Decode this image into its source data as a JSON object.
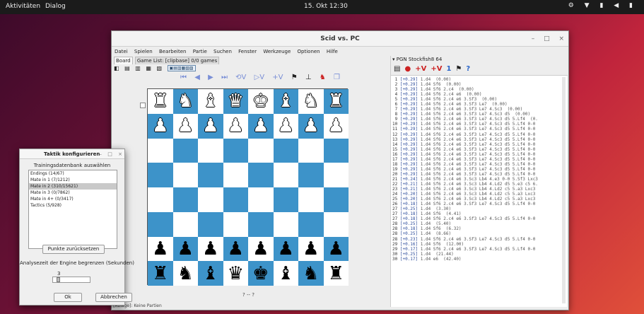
{
  "topbar": {
    "activities": "Aktivitäten",
    "app": "Dialog",
    "clock": "15. Okt 12:30",
    "tray": "⚙ ▼ ▮ ◀ ▮"
  },
  "window": {
    "title": "Scid vs. PC",
    "controls": [
      "–",
      "□",
      "×"
    ],
    "menu": [
      "Datei",
      "Spielen",
      "Bearbeiten",
      "Partie",
      "Suchen",
      "Fenster",
      "Werkzeuge",
      "Optionen",
      "Hilfe"
    ]
  },
  "board_panel": {
    "tabs": [
      "Board",
      "Game List: [clipbase] 0/0 games"
    ],
    "toolbar_icons": [
      "◧",
      "▤",
      "▥",
      "▦",
      "▧"
    ],
    "toolbar_box": "▣▤▥▦▧▨",
    "nav": [
      "⏮",
      "◀",
      "▶",
      "⏭",
      "⟲V",
      "▷V",
      "+V",
      "⚑",
      "⊥",
      "♞",
      "❐"
    ],
    "footer": "? -- ?",
    "status": "[Ablage]: Keine Partien"
  },
  "board": {
    "squares": [
      [
        "♜",
        "♞",
        "♝",
        "♛",
        "♚",
        "♝",
        "♞",
        "♜"
      ],
      [
        "♟",
        "♟",
        "♟",
        "♟",
        "♟",
        "♟",
        "♟",
        "♟"
      ],
      [
        "",
        "",
        "",
        "",
        "",
        "",
        "",
        ""
      ],
      [
        "",
        "",
        "",
        "",
        "",
        "",
        "",
        ""
      ],
      [
        "",
        "",
        "",
        "",
        "",
        "",
        "",
        ""
      ],
      [
        "",
        "",
        "",
        "",
        "",
        "",
        "",
        ""
      ],
      [
        "♟",
        "♟",
        "♟",
        "♟",
        "♟",
        "♟",
        "♟",
        "♟"
      ],
      [
        "♜",
        "♞",
        "♝",
        "♛",
        "♚",
        "♝",
        "♞",
        "♜"
      ]
    ],
    "colors": [
      [
        "w",
        "w",
        "w",
        "w",
        "w",
        "w",
        "w",
        "w"
      ],
      [
        "w",
        "w",
        "w",
        "w",
        "w",
        "w",
        "w",
        "w"
      ],
      [
        "",
        "",
        "",
        "",
        "",
        "",
        "",
        ""
      ],
      [
        "",
        "",
        "",
        "",
        "",
        "",
        "",
        ""
      ],
      [
        "",
        "",
        "",
        "",
        "",
        "",
        "",
        ""
      ],
      [
        "",
        "",
        "",
        "",
        "",
        "",
        "",
        ""
      ],
      [
        "b",
        "b",
        "b",
        "b",
        "b",
        "b",
        "b",
        "b"
      ],
      [
        "b",
        "b",
        "b",
        "b",
        "b",
        "b",
        "b",
        "b"
      ]
    ],
    "light": "#ffffff",
    "dark": "#3d93c9"
  },
  "engine_panel": {
    "tabs": "▾ PGN  Stockfish8 64",
    "toolbar": [
      [
        "▤",
        ""
      ],
      [
        "●",
        "r"
      ],
      [
        "+V",
        "r"
      ],
      [
        "+V",
        "r"
      ],
      [
        "1",
        "b"
      ],
      [
        "⚑",
        ""
      ],
      [
        "?",
        "b"
      ]
    ],
    "lines": [
      [
        "1",
        "[+0.29]",
        "1.d4  (0.00)"
      ],
      [
        "2",
        "[+0.29]",
        "1.d4 Sf6  (0.00)"
      ],
      [
        "3",
        "[+0.29]",
        "1.d4 Sf6 2.c4  (0.00)"
      ],
      [
        "4",
        "[+0.29]",
        "1.d4 Sf6 2.c4 e6  (0.00)"
      ],
      [
        "5",
        "[+0.29]",
        "1.d4 Sf6 2.c4 e6 3.Sf3  (0.00)"
      ],
      [
        "6",
        "[+0.29]",
        "1.d4 Sf6 2.c4 e6 3.Sf3 Le7  (0.00)"
      ],
      [
        "7",
        "[+0.29]",
        "1.d4 Sf6 2.c4 e6 3.Sf3 Le7 4.Sc3  (0.00)"
      ],
      [
        "8",
        "[+0.29]",
        "1.d4 Sf6 2.c4 e6 3.Sf3 Le7 4.Sc3 d5  (0.00)"
      ],
      [
        "9",
        "[+0.29]",
        "1.d4 Sf6 2.c4 e6 3.Sf3 Le7 4.Sc3 d5 5.Lf4  (0."
      ],
      [
        "10",
        "[+0.29]",
        "1.d4 Sf6 2.c4 e6 3.Sf3 Le7 4.Sc3 d5 5.Lf4 0-0"
      ],
      [
        "11",
        "[+0.29]",
        "1.d4 Sf6 2.c4 e6 3.Sf3 Le7 4.Sc3 d5 5.Lf4 0-0"
      ],
      [
        "12",
        "[+0.29]",
        "1.d4 Sf6 2.c4 e6 3.Sf3 Le7 4.Sc3 d5 5.Lf4 0-0"
      ],
      [
        "13",
        "[+0.29]",
        "1.d4 Sf6 2.c4 e6 3.Sf3 Le7 4.Sc3 d5 5.Lf4 0-0"
      ],
      [
        "14",
        "[+0.29]",
        "1.d4 Sf6 2.c4 e6 3.Sf3 Le7 4.Sc3 d5 5.Lf4 0-0"
      ],
      [
        "15",
        "[+0.29]",
        "1.d4 Sf6 2.c4 e6 3.Sf3 Le7 4.Sc3 d5 5.Lf4 0-0"
      ],
      [
        "16",
        "[+0.29]",
        "1.d4 Sf6 2.c4 e6 3.Sf3 Le7 4.Sc3 d5 5.Lf4 0-0"
      ],
      [
        "17",
        "[+0.29]",
        "1.d4 Sf6 2.c4 e6 3.Sf3 Le7 4.Sc3 d5 5.Lf4 0-0"
      ],
      [
        "18",
        "[+0.29]",
        "1.d4 Sf6 2.c4 e6 3.Sf3 Le7 4.Sc3 d5 5.Lf4 0-0"
      ],
      [
        "19",
        "[+0.29]",
        "1.d4 Sf6 2.c4 e6 3.Sf3 Le7 4.Sc3 d5 5.Lf4 0-0"
      ],
      [
        "20",
        "[+0.29]",
        "1.d4 Sf6 2.c4 e6 3.Sf3 Le7 4.Sc3 d5 5.Lf4 0-0"
      ],
      [
        "21",
        "[+0.24]",
        "1.d4 Sf6 2.c4 e6 3.Sc3 Lb4 4.e3 0-0 5.Sf3 Lxc3"
      ],
      [
        "22",
        "[+0.21]",
        "1.d4 Sf6 2.c4 e6 3.Sc3 Lb4 4.Ld2 d5 5.e3 c5 6."
      ],
      [
        "23",
        "[+0.21]",
        "1.d4 Sf6 2.c4 e6 3.Sc3 Lb4 4.Ld2 c5 5.a3 Lxc3"
      ],
      [
        "24",
        "[+0.20]",
        "1.d4 Sf6 2.c4 e6 3.Sc3 Lb4 4.Ld2 c5 5.a3 Lxc3"
      ],
      [
        "25",
        "[+0.20]",
        "1.d4 Sf6 2.c4 e6 3.Sc3 Lb4 4.Ld2 c5 5.a3 Lxc3"
      ],
      [
        "26",
        "[+0.18]",
        "1.d4 Sf6 2.c4 e6 3.Sf3 Le7 4.Sc3 d5 5.Lf4 0-0"
      ],
      [
        "27",
        "[+0.25]",
        "1.d4  (3.30)"
      ],
      [
        "27",
        "[+0.18]",
        "1.d4 Sf6  (4.41)"
      ],
      [
        "27",
        "[+0.18]",
        "1.d4 Sf6 2.c4 e6 3.Sf3 Le7 4.Sc3 d5 5.Lf4 0-0"
      ],
      [
        "28",
        "[+0.25]",
        "1.d4  (5.40)"
      ],
      [
        "28",
        "[+0.18]",
        "1.d4 Sf6  (6.32)"
      ],
      [
        "28",
        "[+0.25]",
        "1.d4  (8.66)"
      ],
      [
        "28",
        "[+0.23]",
        "1.d4 Sf6 2.c4 e6 3.Sf3 Le7 4.Sc3 d5 5.Lf4 0-0"
      ],
      [
        "29",
        "[+0.16]",
        "1.d4 Sf6  (12.00)"
      ],
      [
        "29",
        "[+0.17]",
        "1.d4 Sf6 2.c4 e6 3.Sf3 Le7 4.Sc3 d5 5.Lf4 0-0"
      ],
      [
        "30",
        "[+0.25]",
        "1.d4  (21.44)"
      ],
      [
        "30",
        "[+0.17]",
        "1.d4 e6  (42.40)"
      ]
    ]
  },
  "dialog": {
    "title": "Taktik konfigurieren",
    "controls": [
      "–",
      "□",
      "×"
    ],
    "subtitle": "Trainingsdatenbank auswählen",
    "items": [
      {
        "label": "Endings  (14/67)",
        "selected": false
      },
      {
        "label": "Mate in 1  (7/1212)",
        "selected": false
      },
      {
        "label": "Mate in 2  (310/15621)",
        "selected": true
      },
      {
        "label": "Mate in 3  (0/7862)",
        "selected": false
      },
      {
        "label": "Mate in 4+  (0/3417)",
        "selected": false
      },
      {
        "label": "Tactics  (5/928)",
        "selected": false
      }
    ],
    "reset_button": "Punkte zurücksetzen",
    "engine_label": "Analysezeit der Engine begrenzen (Sekunden)",
    "slider_value": "3",
    "slider_level": 0.1,
    "ok_button": "Ok",
    "cancel_button": "Abbrechen"
  }
}
